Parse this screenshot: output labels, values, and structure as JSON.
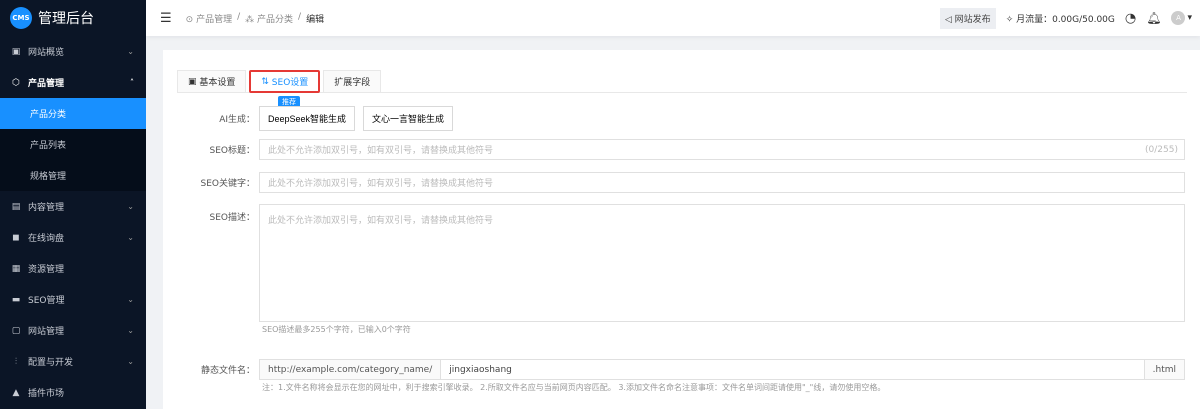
{
  "app": {
    "logo": "CMS",
    "title": "管理后台"
  },
  "sidebar": {
    "items": [
      {
        "label": "网站概览",
        "icon": "monitor-icon"
      },
      {
        "label": "产品管理",
        "icon": "cube-icon",
        "open": true,
        "children": [
          {
            "label": "产品分类",
            "active": true
          },
          {
            "label": "产品列表"
          },
          {
            "label": "规格管理"
          }
        ]
      },
      {
        "label": "内容管理",
        "icon": "document-icon"
      },
      {
        "label": "在线询盘",
        "icon": "chat-icon"
      },
      {
        "label": "资源管理",
        "icon": "folder-icon"
      },
      {
        "label": "SEO管理",
        "icon": "seo-icon"
      },
      {
        "label": "网站管理",
        "icon": "site-icon"
      },
      {
        "label": "配置与开发",
        "icon": "sliders-icon"
      },
      {
        "label": "插件市场",
        "icon": "plugin-icon"
      }
    ]
  },
  "header": {
    "breadcrumb": [
      "产品管理",
      "产品分类",
      "编辑"
    ],
    "publish": "网站发布",
    "traffic": "月流量：0.00G/50.00G",
    "avatar": "A"
  },
  "tabs": [
    "基本设置",
    "SEO设置",
    "扩展字段"
  ],
  "tag": "推荐",
  "form": {
    "ai_label": "AI生成：",
    "ai_buttons": [
      "DeepSeek智能生成",
      "文心一言智能生成"
    ],
    "title_label": "SEO标题：",
    "title_placeholder": "此处不允许添加双引号，如有双引号，请替换成其他符号",
    "title_count": "(0/255)",
    "keywords_label": "SEO关键字：",
    "keywords_placeholder": "此处不允许添加双引号，如有双引号，请替换成其他符号",
    "desc_label": "SEO描述：",
    "desc_placeholder": "此处不允许添加双引号，如有双引号，请替换成其他符号",
    "desc_hint": "SEO描述最多255个字符，已输入0个字符",
    "file_label": "静态文件名：",
    "file_prefix": "http://example.com/category_name/",
    "file_value": "jingxiaoshang",
    "file_suffix": ".html",
    "file_note": "注：1.文件名称将会显示在您的网址中，利于搜索引擎收录。 2.所取文件名应与当前网页内容匹配。 3.添加文件名命名注意事项：文件名单词间距请使用\"_\"线，请勿使用空格。"
  }
}
